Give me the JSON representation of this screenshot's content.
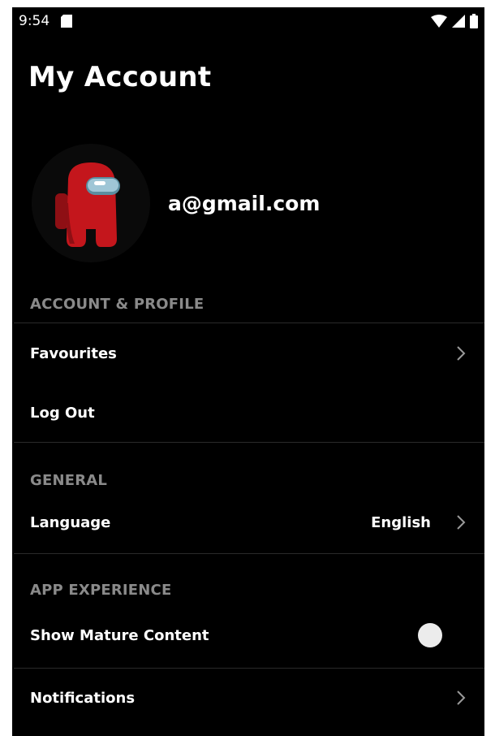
{
  "status_bar": {
    "time": "9:54",
    "icons": [
      "sd-card-icon",
      "wifi-icon",
      "signal-icon",
      "battery-icon"
    ]
  },
  "header": {
    "title": "My Account"
  },
  "profile": {
    "avatar_icon": "crewmate-avatar-icon",
    "email": "a@gmail.com"
  },
  "sections": {
    "account_profile": {
      "header": "ACCOUNT & PROFILE",
      "favourites_label": "Favourites",
      "logout_label": "Log Out"
    },
    "general": {
      "header": "GENERAL",
      "language_label": "Language",
      "language_value": "English"
    },
    "app_experience": {
      "header": "APP EXPERIENCE",
      "mature_label": "Show Mature Content",
      "mature_enabled": false,
      "notifications_label": "Notifications"
    }
  },
  "colors": {
    "background": "#000000",
    "text": "#ffffff",
    "section_header": "#8a8a8a",
    "chevron": "#9a9a9a",
    "avatar_red": "#c4161c",
    "visor": "#9fc6d6"
  }
}
